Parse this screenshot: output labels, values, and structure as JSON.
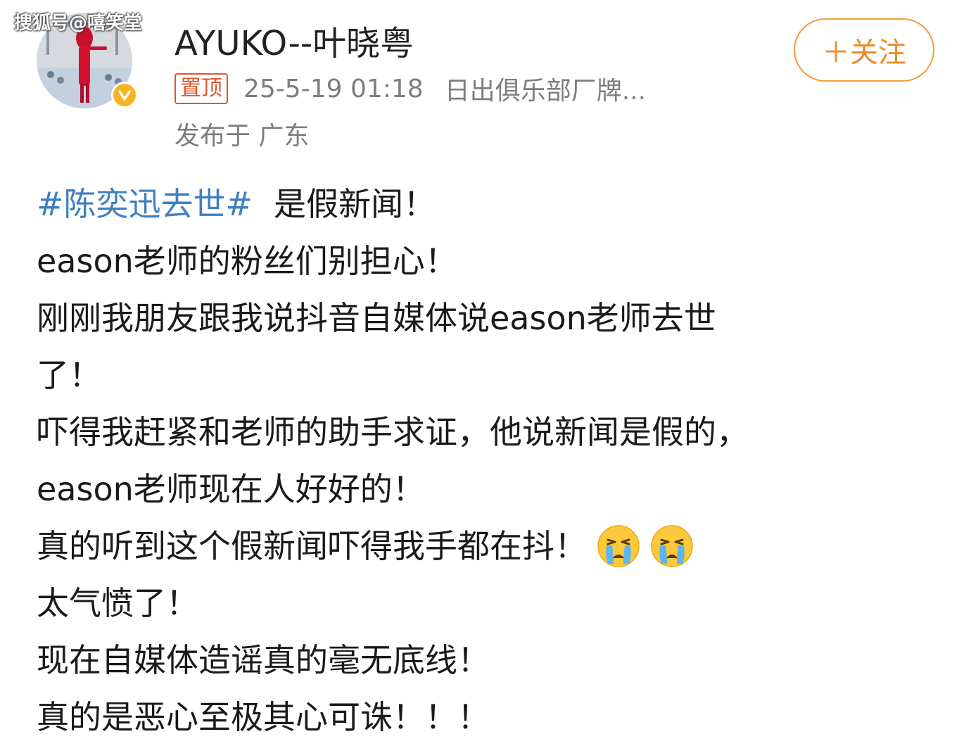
{
  "watermark": "搜狐号@嘻笑堂",
  "user": {
    "name": "AYUKO--叶晓粤"
  },
  "meta": {
    "pinned_label": "置顶",
    "timestamp": "25-5-19 01:18",
    "source": "日出俱乐部厂牌...",
    "location": "发布于 广东"
  },
  "follow_label": "＋关注",
  "post": {
    "hashtag": "#陈奕迅去世#",
    "line1_rest": "是假新闻！",
    "line2": "eason老师的粉丝们别担心！",
    "line3": "刚刚我朋友跟我说抖音自媒体说eason老师去世",
    "line4": "了！",
    "line5": "吓得我赶紧和老师的助手求证，他说新闻是假的，",
    "line6": "eason老师现在人好好的！",
    "line7": "真的听到这个假新闻吓得我手都在抖！",
    "line8": "太气愤了！",
    "line9": "现在自媒体造谣真的毫无底线！",
    "line10": "真的是恶心至极其心可诛！！！"
  },
  "colors": {
    "hashtag": "#3f7fc0",
    "follow": "#f08a28",
    "pinned": "#e2572f",
    "meta_text": "#7d7d7d",
    "verified": "#f5b423"
  },
  "icons": {
    "verified": "verified-badge-icon",
    "emoji": "crying-face-emoji"
  }
}
